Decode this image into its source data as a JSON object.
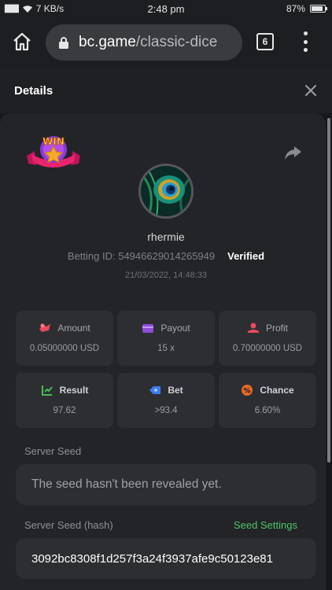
{
  "status_bar": {
    "signal": "▉▉▉",
    "network_speed": "7 KB/s",
    "time": "2:48 pm",
    "battery": "87%",
    "battery_level": 0.87
  },
  "browser": {
    "domain": "bc.game",
    "path": "/classic-dice",
    "tab_count": "6"
  },
  "header": {
    "title": "Details"
  },
  "bet": {
    "badge": "WIN",
    "username": "rhermie",
    "betting_id": "Betting ID: 54946629014265949",
    "verified": "Verified",
    "timestamp": "21/03/2022, 14:48:33"
  },
  "stats": [
    {
      "label": "Amount",
      "value": "0.05000000 USD",
      "icon": "amount-icon",
      "color": "#e84a62"
    },
    {
      "label": "Payout",
      "value": "15 x",
      "icon": "payout-icon",
      "color": "#8b4fd8"
    },
    {
      "label": "Profit",
      "value": "0.70000000 USD",
      "icon": "profit-icon",
      "color": "#e84a62"
    },
    {
      "label": "Result",
      "value": "97.62",
      "icon": "result-icon",
      "color": "#49b85a"
    },
    {
      "label": "Bet",
      "value": ">93.4",
      "icon": "bet-icon",
      "color": "#3a7ef0"
    },
    {
      "label": "Chance",
      "value": "6.60%",
      "icon": "chance-icon",
      "color": "#e56a22"
    }
  ],
  "seeds": {
    "server_seed_label": "Server Seed",
    "server_seed_value": "The seed hasn't been revealed yet.",
    "server_seed_hash_label": "Server Seed (hash)",
    "seed_settings_link": "Seed Settings",
    "server_seed_hash_value": "3092bc8308f1d257f3a24f3937afe9c50123e81"
  }
}
